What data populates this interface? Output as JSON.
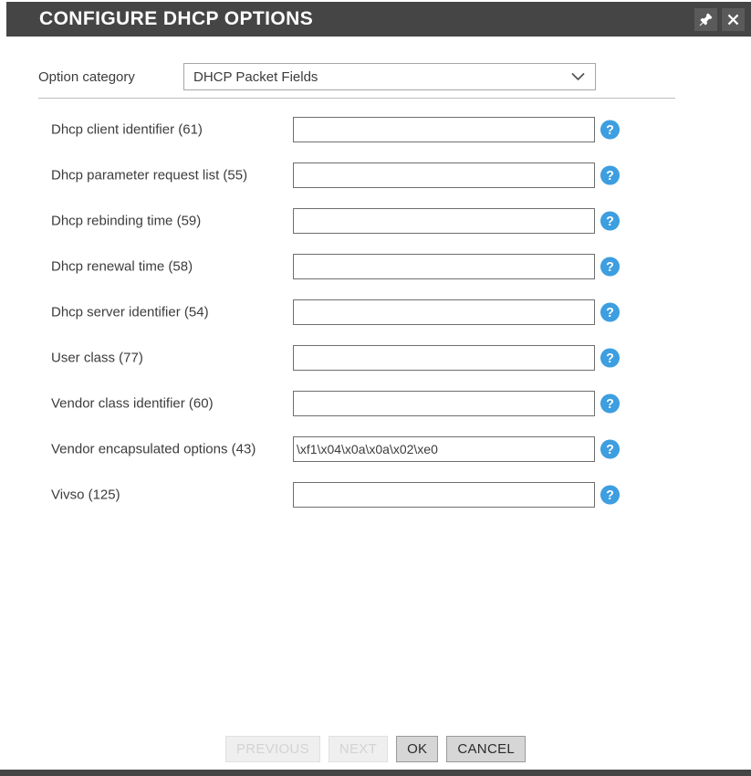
{
  "window": {
    "title": "CONFIGURE DHCP OPTIONS",
    "pin_icon": "pin-icon",
    "close_icon": "close-icon"
  },
  "category": {
    "label": "Option category",
    "selected": "DHCP Packet Fields",
    "chevron_icon": "chevron-down-icon"
  },
  "fields": [
    {
      "label": "Dhcp client identifier (61)",
      "value": "",
      "help_icon": "help-icon"
    },
    {
      "label": "Dhcp parameter request list (55)",
      "value": "",
      "help_icon": "help-icon"
    },
    {
      "label": "Dhcp rebinding time (59)",
      "value": "",
      "help_icon": "help-icon"
    },
    {
      "label": "Dhcp renewal time (58)",
      "value": "",
      "help_icon": "help-icon"
    },
    {
      "label": "Dhcp server identifier (54)",
      "value": "",
      "help_icon": "help-icon"
    },
    {
      "label": "User class (77)",
      "value": "",
      "help_icon": "help-icon"
    },
    {
      "label": "Vendor class identifier (60)",
      "value": "",
      "help_icon": "help-icon"
    },
    {
      "label": "Vendor encapsulated options (43)",
      "value": "\\xf1\\x04\\x0a\\x0a\\x02\\xe0",
      "help_icon": "help-icon"
    },
    {
      "label": "Vivso (125)",
      "value": "",
      "help_icon": "help-icon"
    }
  ],
  "buttons": [
    {
      "label": "PREVIOUS",
      "enabled": false
    },
    {
      "label": "NEXT",
      "enabled": false
    },
    {
      "label": "OK",
      "enabled": true
    },
    {
      "label": "CANCEL",
      "enabled": true
    }
  ],
  "colors": {
    "titlebar_bg": "#454545",
    "help_blue": "#3d9ee0",
    "text": "#3c3c3c",
    "input_border": "#6e6e6e"
  }
}
